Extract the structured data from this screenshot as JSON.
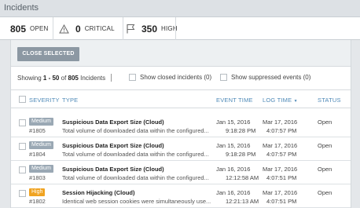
{
  "header": {
    "title": "Incidents"
  },
  "stats": [
    {
      "count": "805",
      "label": "OPEN",
      "icon": "none"
    },
    {
      "count": "0",
      "label": "CRITICAL",
      "icon": "warning-triangle-icon"
    },
    {
      "count": "350",
      "label": "HIGH",
      "icon": "flag-icon"
    }
  ],
  "toolbar": {
    "close_selected_label": "CLOSE SELECTED"
  },
  "summary": {
    "prefix": "Showing ",
    "range": "1 - 50",
    "of": " of ",
    "total": "805",
    "suffix": " Incidents"
  },
  "filters": {
    "show_closed_label": "Show closed incidents (0)",
    "show_suppressed_label": "Show suppressed events (0)"
  },
  "table": {
    "columns": {
      "severity": "SEVERITY",
      "type": "TYPE",
      "event_time": "EVENT TIME",
      "log_time": "LOG TIME",
      "log_time_sort": "▼",
      "status": "STATUS"
    },
    "rows": [
      {
        "severity": "Medium",
        "severity_color": "#9aa8b4",
        "id": "#1805",
        "type": "Suspicious Data Export Size (Cloud)",
        "desc": "Total volume of downloaded data within the configured...",
        "event_date": "Jan 15, 2016",
        "event_time": "9:18:28 PM",
        "log_date": "Mar 17, 2016",
        "log_time": "4:07:57 PM",
        "status": "Open"
      },
      {
        "severity": "Medium",
        "severity_color": "#9aa8b4",
        "id": "#1804",
        "type": "Suspicious Data Export Size (Cloud)",
        "desc": "Total volume of downloaded data within the configured...",
        "event_date": "Jan 15, 2016",
        "event_time": "9:18:28 PM",
        "log_date": "Mar 17, 2016",
        "log_time": "4:07:57 PM",
        "status": "Open"
      },
      {
        "severity": "Medium",
        "severity_color": "#9aa8b4",
        "id": "#1803",
        "type": "Suspicious Data Export Size (Cloud)",
        "desc": "Total volume of downloaded data within the configured...",
        "event_date": "Jan 16, 2016",
        "event_time": "12:12:58 AM",
        "log_date": "Mar 17, 2016",
        "log_time": "4:07:51 PM",
        "status": "Open"
      },
      {
        "severity": "High",
        "severity_color": "#f0a321",
        "id": "#1802",
        "type": "Session Hijacking (Cloud)",
        "desc": "Identical web session cookies were simultaneously use...",
        "event_date": "Jan 16, 2016",
        "event_time": "12:21:13 AM",
        "log_date": "Mar 17, 2016",
        "log_time": "4:07:51 PM",
        "status": "Open"
      }
    ]
  }
}
